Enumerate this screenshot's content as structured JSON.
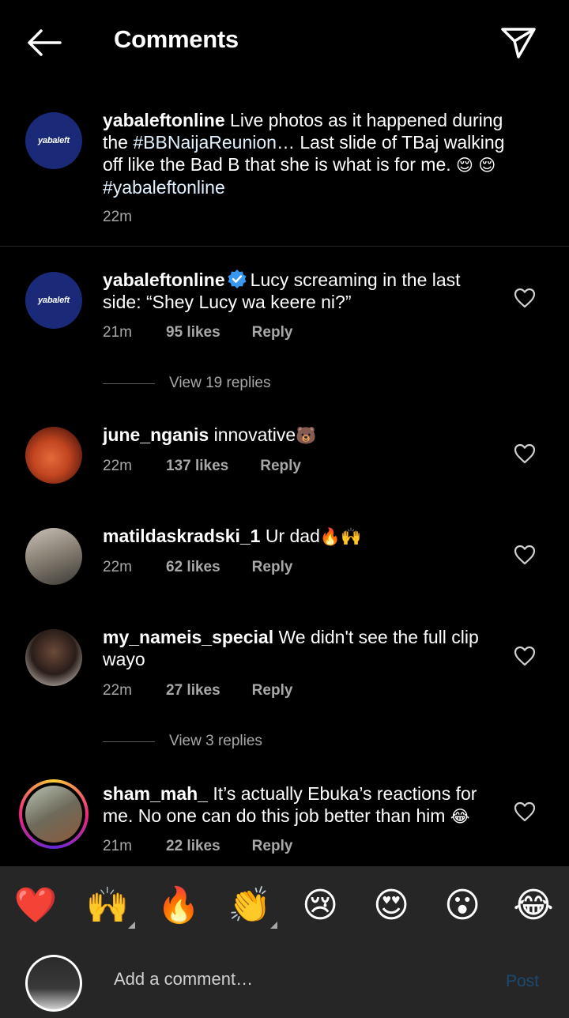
{
  "header": {
    "title": "Comments"
  },
  "caption": {
    "avatar_logo": "yabaleft",
    "username": "yabaleftonline",
    "text_1": "Live photos as it happened during the ",
    "hashtag_1": "#BBNaijaReunion",
    "text_2": "… Last slide of TBaj walking off like the Bad B that she is what is for me. ",
    "emoji_1": "😌",
    "emoji_2": "😌",
    "hashtag_2": "#yabaleftonline",
    "time": "22m"
  },
  "comments": [
    {
      "avatar_logo": "yabaleft",
      "username": "yabaleftonline",
      "text": "Lucy screaming in the last side: “Shey Lucy wa keere ni?”",
      "time": "21m",
      "likes": "95 likes",
      "reply": "Reply",
      "view_replies": "View 19 replies"
    },
    {
      "username": "june_nganis",
      "text": "innovative",
      "emoji": "🐻",
      "time": "22m",
      "likes": "137 likes",
      "reply": "Reply"
    },
    {
      "username": "matildaskradski_1",
      "text": "Ur dad",
      "emoji": "🔥🙌",
      "time": "22m",
      "likes": "62 likes",
      "reply": "Reply"
    },
    {
      "username": "my_nameis_special",
      "text": "We didn't see the full clip wayo",
      "time": "22m",
      "likes": "27 likes",
      "reply": "Reply",
      "view_replies": "View 3 replies"
    },
    {
      "username": "sham_mah_",
      "text": "It’s actually Ebuka’s reactions for me. No one can do this job better than him ",
      "emoji": "😂",
      "time": "21m",
      "likes": "22 likes",
      "reply": "Reply"
    }
  ],
  "emoji_bar": [
    "❤️",
    "🙌",
    "🔥",
    "👏",
    "😢",
    "😍",
    "😮",
    "😂"
  ],
  "input": {
    "placeholder": "Add a comment…",
    "post_label": "Post"
  },
  "colors": {
    "background": "#000000",
    "bar": "#262626",
    "meta": "#a8a8a8",
    "post_disabled": "#1b4a73",
    "verified": "#3897f0"
  }
}
